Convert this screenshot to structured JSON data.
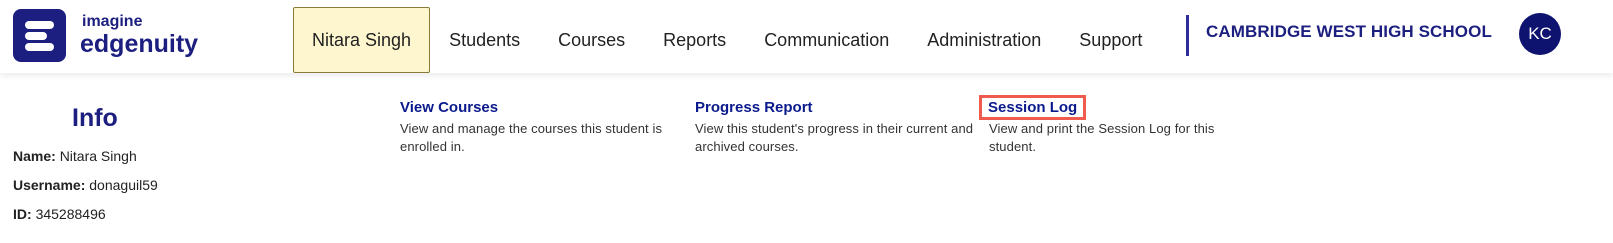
{
  "logo": {
    "line1": "imagine",
    "line2": "edgenuity",
    "brand_color": "#1c1f7f"
  },
  "nav": {
    "items": [
      {
        "label": "Nitara Singh",
        "active": true
      },
      {
        "label": "Students"
      },
      {
        "label": "Courses"
      },
      {
        "label": "Reports"
      },
      {
        "label": "Communication"
      },
      {
        "label": "Administration"
      },
      {
        "label": "Support"
      }
    ]
  },
  "school": "CAMBRIDGE WEST HIGH SCHOOL",
  "user": {
    "initials": "KC"
  },
  "info": {
    "title": "Info",
    "name_label": "Name:",
    "name_value": "Nitara Singh",
    "username_label": "Username:",
    "username_value": "donaguil59",
    "id_label": "ID:",
    "id_value": "345288496"
  },
  "cards": [
    {
      "title": "View Courses",
      "desc": "View and manage the courses this student is enrolled in."
    },
    {
      "title": "Progress Report",
      "desc": "View this student's progress in their current and archived courses."
    },
    {
      "title": "Session Log",
      "desc": "View and print the Session Log for this student.",
      "highlighted": true
    }
  ],
  "colors": {
    "active_tab_bg": "#fdf6cf",
    "link": "#0b1a8c",
    "highlight_outline": "#ef5b4d"
  }
}
